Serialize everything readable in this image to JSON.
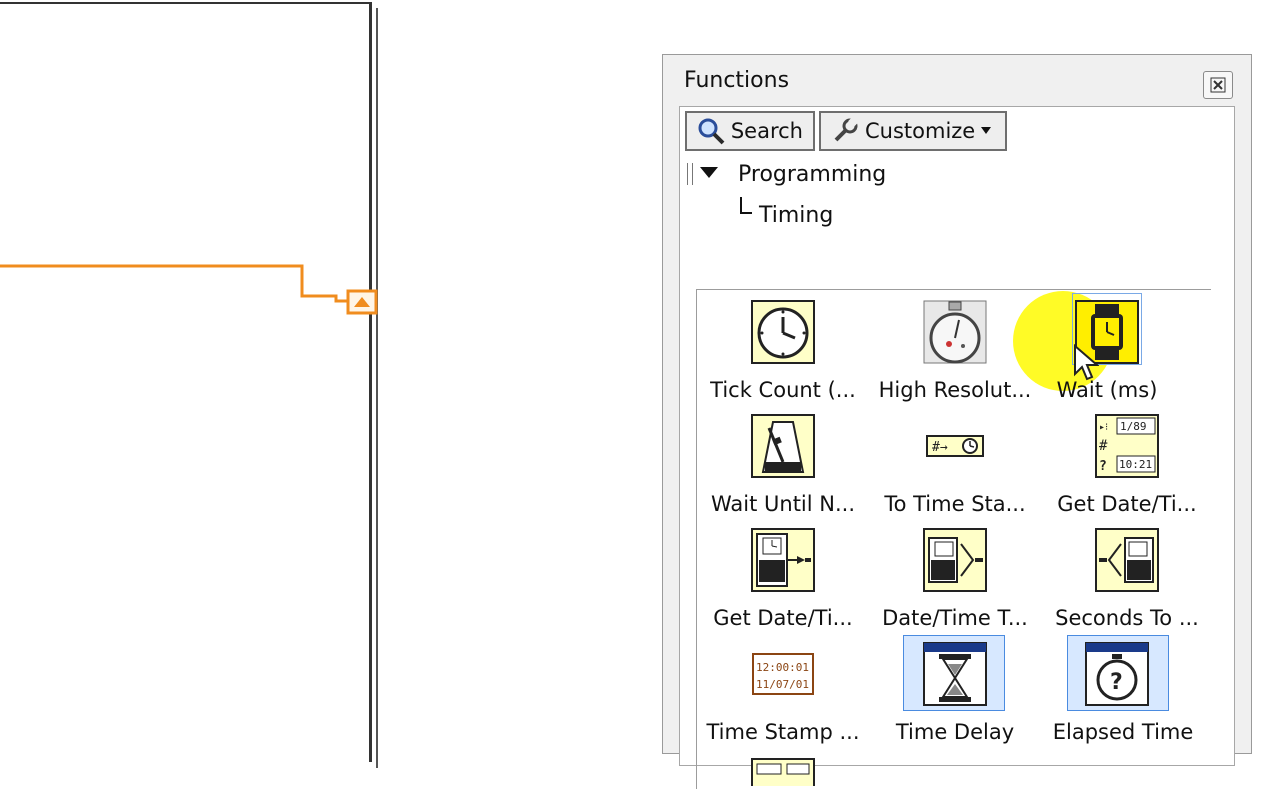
{
  "palette": {
    "title": "Functions",
    "toolbar": {
      "search_label": "Search",
      "customize_label": "Customize"
    },
    "tree": {
      "root": "Programming",
      "child": "Timing"
    },
    "items": [
      {
        "label": "Tick Count (...",
        "icon": "clock-icon"
      },
      {
        "label": "High Resolut...",
        "icon": "stopwatch-icon"
      },
      {
        "label": "Wait (ms)",
        "icon": "wristwatch-icon"
      },
      {
        "label": "Wait Until N...",
        "icon": "metronome-icon"
      },
      {
        "label": "To Time Sta...",
        "icon": "to-timestamp-icon"
      },
      {
        "label": "Get Date/Ti...",
        "icon": "date-time-string-icon"
      },
      {
        "label": "Get Date/Ti...",
        "icon": "date-time-seconds-icon"
      },
      {
        "label": "Date/Time T...",
        "icon": "date-time-to-seconds-icon"
      },
      {
        "label": "Seconds To ...",
        "icon": "seconds-to-date-icon"
      },
      {
        "label": "Time Stamp ...",
        "icon": "timestamp-constant-icon"
      },
      {
        "label": "Time Delay",
        "icon": "hourglass-icon"
      },
      {
        "label": "Elapsed Time",
        "icon": "elapsed-stopwatch-icon"
      }
    ],
    "timestamp_constant": {
      "time": "12:00:01",
      "date": "11/07/01"
    },
    "date_string_icon": {
      "top": "1/89",
      "bottom": "10:21"
    }
  },
  "colors": {
    "wire": "#f08c1e",
    "icon_yellow": "#ffffc8",
    "highlight": "#fff700",
    "selection": "#d7e8ff"
  }
}
